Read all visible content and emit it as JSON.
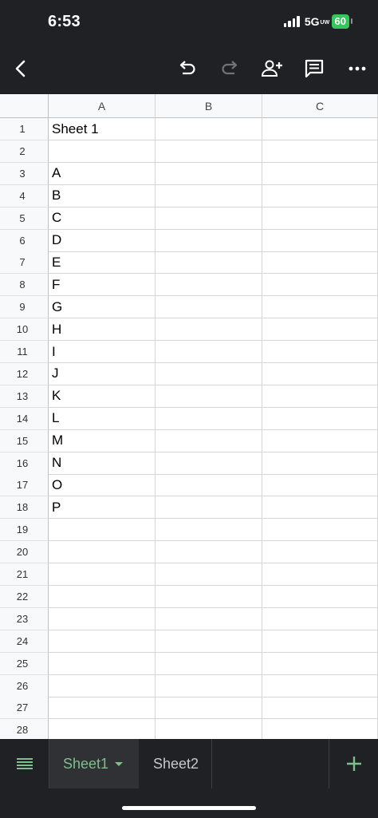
{
  "status": {
    "time": "6:53",
    "network": "5G",
    "network_sub": "UW",
    "battery": "60"
  },
  "toolbar": {
    "back_icon": "chevron-left-icon",
    "undo_icon": "undo-icon",
    "redo_icon": "redo-icon",
    "share_icon": "person-add-icon",
    "comment_icon": "comment-icon",
    "more_icon": "more-horizontal-icon"
  },
  "grid": {
    "columns": [
      "A",
      "B",
      "C"
    ],
    "rows": [
      {
        "num": "1",
        "a": "Sheet 1"
      },
      {
        "num": "2",
        "a": ""
      },
      {
        "num": "3",
        "a": "A"
      },
      {
        "num": "4",
        "a": "B"
      },
      {
        "num": "5",
        "a": "C"
      },
      {
        "num": "6",
        "a": "D"
      },
      {
        "num": "7",
        "a": "E"
      },
      {
        "num": "8",
        "a": "F"
      },
      {
        "num": "9",
        "a": "G"
      },
      {
        "num": "10",
        "a": "H"
      },
      {
        "num": "11",
        "a": "I"
      },
      {
        "num": "12",
        "a": "J"
      },
      {
        "num": "13",
        "a": "K"
      },
      {
        "num": "14",
        "a": "L"
      },
      {
        "num": "15",
        "a": "M"
      },
      {
        "num": "16",
        "a": "N"
      },
      {
        "num": "17",
        "a": "O"
      },
      {
        "num": "18",
        "a": "P"
      },
      {
        "num": "19",
        "a": ""
      },
      {
        "num": "20",
        "a": ""
      },
      {
        "num": "21",
        "a": ""
      },
      {
        "num": "22",
        "a": ""
      },
      {
        "num": "23",
        "a": ""
      },
      {
        "num": "24",
        "a": ""
      },
      {
        "num": "25",
        "a": ""
      },
      {
        "num": "26",
        "a": ""
      },
      {
        "num": "27",
        "a": ""
      },
      {
        "num": "28",
        "a": ""
      }
    ]
  },
  "tabs": {
    "menu_icon": "list-icon",
    "items": [
      {
        "label": "Sheet1",
        "active": true
      },
      {
        "label": "Sheet2",
        "active": false
      }
    ],
    "add_icon": "plus-icon"
  },
  "colors": {
    "toolbar_bg": "#202124",
    "accent_green": "#7cc08c",
    "battery_green": "#34c759"
  }
}
